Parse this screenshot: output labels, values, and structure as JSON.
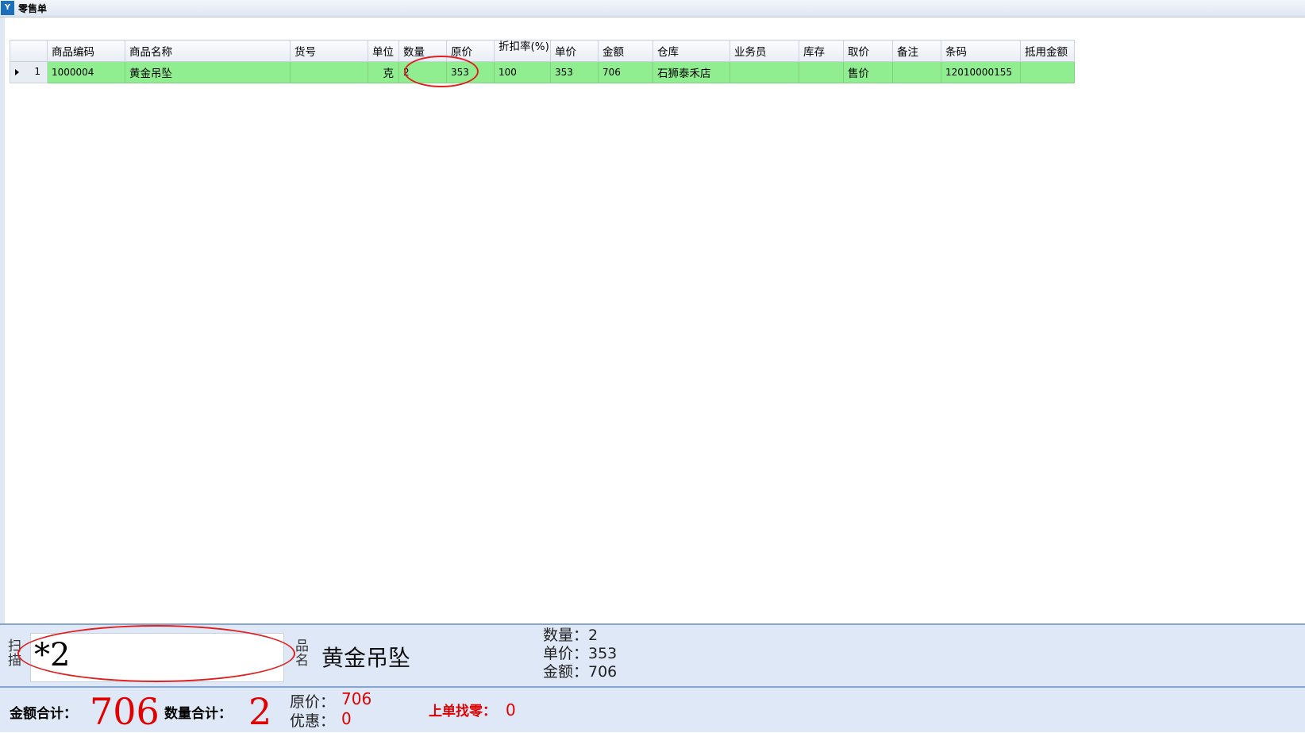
{
  "window": {
    "title": "零售单",
    "icon": "app-logo-icon"
  },
  "grid": {
    "columns": [
      "商品编码",
      "商品名称",
      "货号",
      "单位",
      "数量",
      "原价",
      "折扣率(%)",
      "单价",
      "金额",
      "仓库",
      "业务员",
      "库存",
      "取价",
      "备注",
      "条码",
      "抵用金额"
    ],
    "rows": [
      {
        "index": "1",
        "code": "1000004",
        "name": "黄金吊坠",
        "item_no": "",
        "unit": "克",
        "qty": "2",
        "orig_price": "353",
        "discount": "100",
        "unit_price": "353",
        "amount": "706",
        "warehouse": "石狮泰禾店",
        "salesperson": "",
        "stock": "",
        "price_type": "售价",
        "remark": "",
        "barcode": "12010000155",
        "deduct_amount": ""
      }
    ]
  },
  "scan": {
    "label": "扫描",
    "value": "*2"
  },
  "product_name": {
    "label": "品名",
    "value": "黄金吊坠"
  },
  "info": {
    "qty": "数量：2",
    "price": "单价：353",
    "amount": "金额：706"
  },
  "totals": {
    "amount_label": "金额合计：",
    "amount_value": "706",
    "qty_label": "数量合计：",
    "qty_value": "2",
    "orig_label": "原价：",
    "orig_value": "706",
    "discount_label": "优惠：",
    "discount_value": "0",
    "change_label": "上单找零：",
    "change_value": "0"
  },
  "colors": {
    "selected_row": "#90ee90",
    "accent_red": "#e00000",
    "panel_bg": "#dfe8f6"
  }
}
